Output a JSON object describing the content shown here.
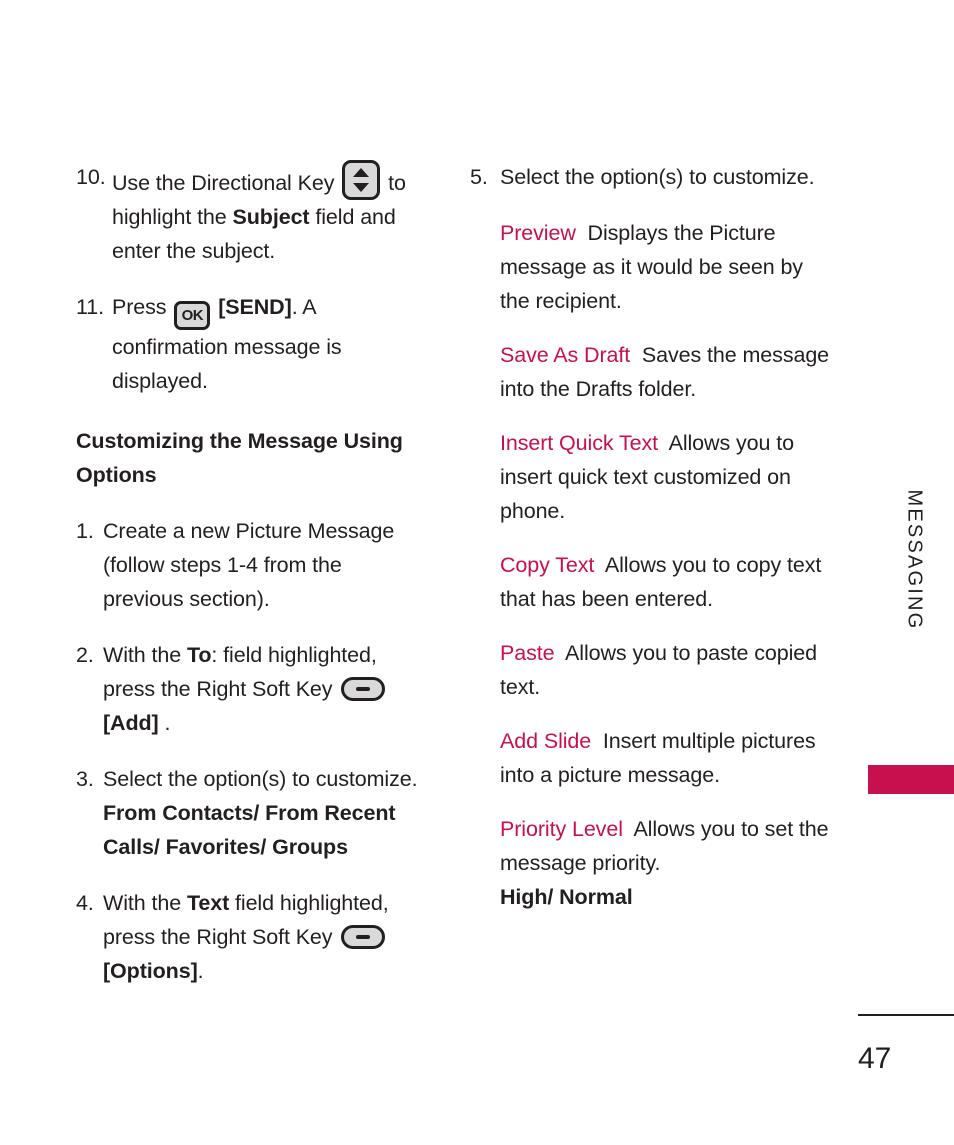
{
  "document": {
    "page_number": "47",
    "side_tab_label": "MESSAGING",
    "accent_color": "#c8104f",
    "text_color": "#231f20"
  },
  "left_column": {
    "steps_continued": [
      {
        "num": "10.",
        "icon": "directional-key",
        "text_before_icon": "Use the Directional Key ",
        "text_after_icon": " to highlight the ",
        "bold_1": "Subject",
        "text_tail": " field and enter the subject."
      },
      {
        "num": "11.",
        "icon": "ok-key",
        "text_before_icon": "Press ",
        "text_after_icon": " ",
        "bold_1": "[SEND]",
        "text_tail": ". A confirmation message is displayed."
      }
    ],
    "section_heading": "Customizing the Message Using Options",
    "steps": [
      {
        "num": "1.",
        "text": "Create a new Picture Message (follow steps 1-4 from the previous section)."
      },
      {
        "num": "2.",
        "text_before_bold": "With the ",
        "bold_1": "To",
        "text_mid": ": field highlighted, press the Right Soft Key ",
        "icon": "soft-key",
        "bold_2": "[Add]",
        "text_tail": " ."
      },
      {
        "num": "3.",
        "text": "Select the option(s) to customize.",
        "bold_values": "From Contacts/ From Recent Calls/ Favorites/ Groups"
      },
      {
        "num": "4.",
        "text_before_bold": "With the ",
        "bold_1": "Text",
        "text_mid": " field highlighted, press the Right Soft Key ",
        "icon": "soft-key",
        "bold_2": "[Options]",
        "text_tail": "."
      }
    ]
  },
  "right_column": {
    "step": {
      "num": "5.",
      "text": "Select the option(s) to customize."
    },
    "options": [
      {
        "name": "Preview",
        "description": "Displays the Picture message as it would be seen by the recipient."
      },
      {
        "name": "Save As Draft",
        "description": "Saves the message into the Drafts folder."
      },
      {
        "name": "Insert Quick Text",
        "description": "Allows you to insert quick text customized on phone."
      },
      {
        "name": "Copy Text",
        "description": "Allows you to copy text that has been entered."
      },
      {
        "name": "Paste",
        "description": "Allows you to paste copied text."
      },
      {
        "name": "Add Slide",
        "description": "Insert multiple pictures into a picture message."
      },
      {
        "name": "Priority Level",
        "description": "Allows you to set the message priority.",
        "values": "High/ Normal"
      }
    ]
  }
}
